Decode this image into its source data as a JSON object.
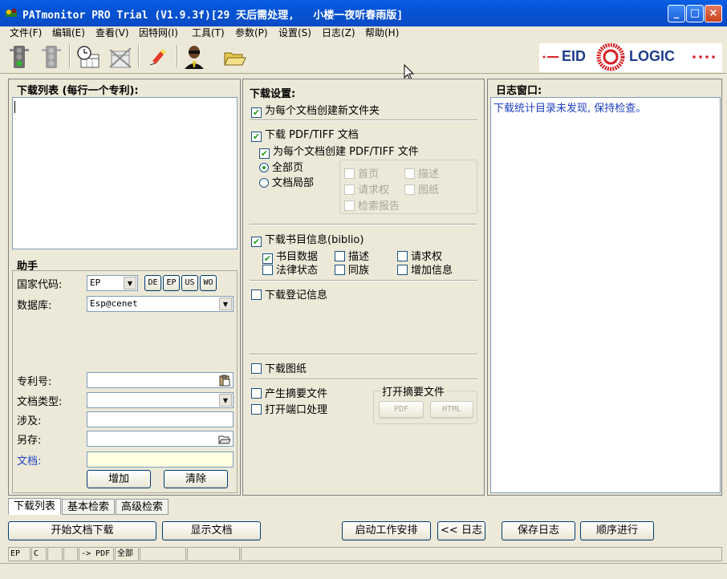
{
  "window": {
    "title": "PATmonitor PRO Trial (V1.9.3f)[29 天后需处理,   小楼一夜听春雨版]",
    "min_label": "_",
    "max_label": "□",
    "close_label": "×"
  },
  "menu": [
    "文件(F)",
    "编辑(E)",
    "查看(V)",
    "因特网(I)",
    "工具(T)",
    "参数(P)",
    "设置(S)",
    "日志(Z)",
    "帮助(H)"
  ],
  "logo": {
    "left": "EID",
    "right": "LOGIC",
    "color": "#d81f26",
    "text_color": "#1f3c8c"
  },
  "toolbar": {
    "icons": [
      "traffic-light-go-icon",
      "traffic-light-stop-icon",
      "clock-calendar-icon",
      "calendar-crossed-icon",
      "highlighter-icon",
      "agent-icon",
      "folder-open-icon"
    ]
  },
  "left": {
    "list_title": "下载列表 (每行一个专利):",
    "assistant": {
      "title": "助手",
      "country_label": "国家代码:",
      "country_value": "EP",
      "country_buttons": [
        "DE",
        "EP",
        "US",
        "WO"
      ],
      "db_label": "数据库:",
      "db_value": "Esp@cenet",
      "patno_label": "专利号:",
      "doctype_label": "文档类型:",
      "involves_label": "涉及:",
      "saveas_label": "另存:",
      "doc_label": "文档:",
      "add_button": "增加",
      "clear_button": "清除"
    }
  },
  "middle": {
    "title": "下载设置:",
    "new_folder": "为每个文档创建新文件夹",
    "download_pdf": "下载 PDF/TIFF 文档",
    "create_pdf_per_doc": "为每个文档创建 PDF/TIFF 文件",
    "all_pages": "全部页",
    "doc_part": "文档局部",
    "parts": [
      "首页",
      "描述",
      "请求权",
      "图纸",
      "检索报告"
    ],
    "download_biblio": "下载书目信息(biblio)",
    "biblio_options": [
      "书目数据",
      "描述",
      "请求权",
      "法律状态",
      "同族",
      "增加信息"
    ],
    "download_register": "下载登记信息",
    "download_drawings": "下载图纸",
    "gen_abstract": "产生摘要文件",
    "open_port": "打开端口处理",
    "open_abstract_group": "打开摘要文件",
    "open_pdf_btn": "PDF",
    "open_html_btn": "HTML"
  },
  "right": {
    "title": "日志窗口:",
    "log_line": "下载统计目录未发现, 保持检查。"
  },
  "tabs": [
    "下载列表",
    "基本检索",
    "高级检索"
  ],
  "buttons": {
    "start": "开始文档下载",
    "show": "显示文档",
    "schedule": "启动工作安排",
    "log": "<< 日志",
    "save_log": "保存日志",
    "sequential": "顺序进行"
  },
  "statusbar": [
    "EP",
    "C",
    "",
    "",
    "-> PDF",
    "全部",
    "",
    ""
  ]
}
